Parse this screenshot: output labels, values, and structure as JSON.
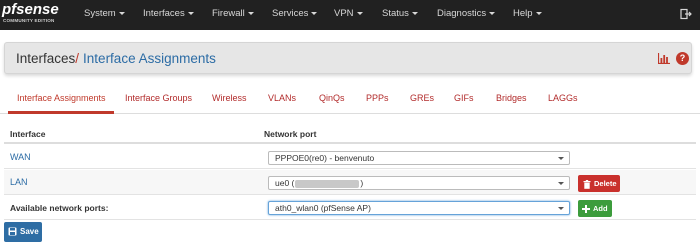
{
  "navbar": {
    "logo": {
      "main": "pfsense",
      "sub": "COMMUNITY EDITION",
      "pf": "pf",
      "sense": "sense"
    },
    "items": [
      {
        "label": "System"
      },
      {
        "label": "Interfaces"
      },
      {
        "label": "Firewall"
      },
      {
        "label": "Services"
      },
      {
        "label": "VPN"
      },
      {
        "label": "Status"
      },
      {
        "label": "Diagnostics"
      },
      {
        "label": "Help"
      }
    ],
    "logout_icon": "logout-icon"
  },
  "header": {
    "root": "Interfaces",
    "separator": "/",
    "current": "Interface Assignments",
    "icons": [
      "bar-chart-icon",
      "help-icon"
    ],
    "help_glyph": "?"
  },
  "tabs": [
    {
      "label": "Interface Assignments",
      "active": true
    },
    {
      "label": "Interface Groups"
    },
    {
      "label": "Wireless"
    },
    {
      "label": "VLANs"
    },
    {
      "label": "QinQs"
    },
    {
      "label": "PPPs"
    },
    {
      "label": "GREs"
    },
    {
      "label": "GIFs"
    },
    {
      "label": "Bridges"
    },
    {
      "label": "LAGGs"
    }
  ],
  "table": {
    "columns": [
      "Interface",
      "Network port"
    ],
    "rows": [
      {
        "interface": "WAN",
        "port": "PPPOE0(re0) - benvenuto"
      },
      {
        "interface": "LAN",
        "port_prefix": "ue0 (",
        "port_suffix": ")",
        "action": "Delete"
      }
    ],
    "available": {
      "label": "Available network ports:",
      "port": "ath0_wlan0 (pfSense AP)",
      "action": "Add"
    }
  },
  "save_label": "Save",
  "colors": {
    "navbar": "#212121",
    "accent_red": "#c0392b",
    "link_blue": "#2c6ca5",
    "delete": "#c9302c",
    "add": "#3c9c3c",
    "save": "#2e6da4"
  }
}
